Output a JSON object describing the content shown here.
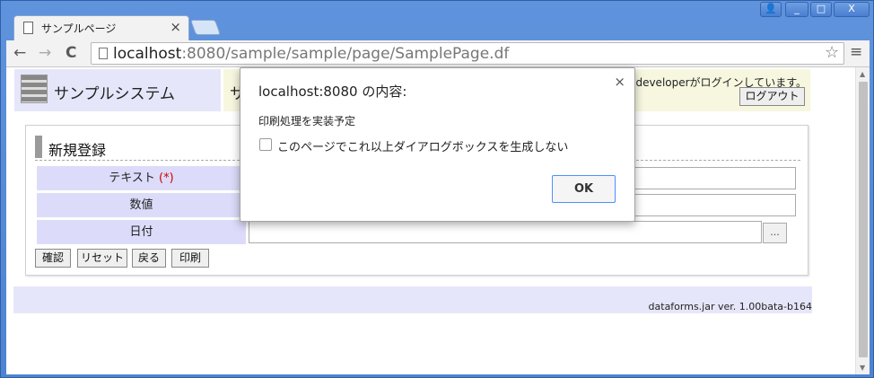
{
  "browser": {
    "tab_title": "サンプルページ",
    "tab_close": "×",
    "url_host": "localhost",
    "url_rest": ":8080/sample/sample/page/SamplePage.df",
    "back": "←",
    "forward": "→",
    "reload": "C",
    "star": "☆",
    "menu": "≡",
    "window_controls": {
      "user": "👤",
      "minimize": "_",
      "maximize": "□",
      "close": "X"
    }
  },
  "page": {
    "system_name": "サンプルシステム",
    "info_partial": "サ",
    "login_message": "developerがログインしています。",
    "logout_label": "ログアウト",
    "panel_title": "新規登録",
    "fields": [
      {
        "label": "テキスト",
        "required_mark": "(*)"
      },
      {
        "label": "数値",
        "required_mark": ""
      },
      {
        "label": "日付",
        "required_mark": ""
      }
    ],
    "date_picker_label": "...",
    "buttons": {
      "confirm": "確認",
      "reset": "リセット",
      "back": "戻る",
      "print": "印刷"
    },
    "version": "dataforms.jar ver. 1.00bata-b164"
  },
  "dialog": {
    "title": "localhost:8080 の内容:",
    "close": "×",
    "message": "印刷処理を実装予定",
    "checkbox_label": "このページでこれ以上ダイアログボックスを生成しない",
    "checkbox_checked": false,
    "ok_label": "OK"
  }
}
